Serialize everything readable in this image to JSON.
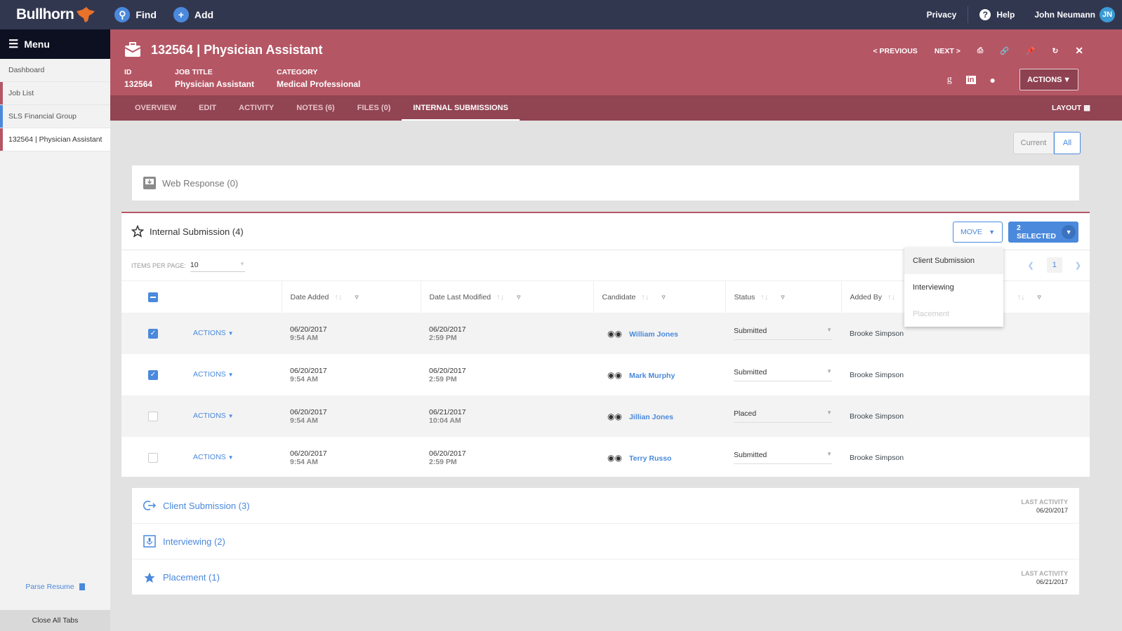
{
  "topbar": {
    "brand": "Bullhorn",
    "find_label": "Find",
    "add_label": "Add",
    "privacy_label": "Privacy",
    "help_label": "Help",
    "user_name": "John Neumann",
    "user_initials": "JN"
  },
  "sidebar": {
    "menu_label": "Menu",
    "items": [
      {
        "label": "Dashboard",
        "color": ""
      },
      {
        "label": "Job List",
        "color": "#b55665"
      },
      {
        "label": "SLS Financial Group",
        "color": "#4a89dc"
      },
      {
        "label": "132564 | Physician Assistant",
        "color": "#b55665"
      }
    ],
    "parse_resume_label": "Parse Resume",
    "close_all_label": "Close All Tabs"
  },
  "header": {
    "title": "132564 | Physician Assistant",
    "fields": [
      {
        "label": "ID",
        "value": "132564"
      },
      {
        "label": "JOB TITLE",
        "value": "Physician Assistant"
      },
      {
        "label": "CATEGORY",
        "value": "Medical Professional"
      }
    ],
    "previous_label": "< PREVIOUS",
    "next_label": "NEXT >",
    "actions_label": "ACTIONS"
  },
  "tabs": {
    "items": [
      "OVERVIEW",
      "EDIT",
      "ACTIVITY",
      "NOTES (6)",
      "FILES (0)",
      "INTERNAL SUBMISSIONS"
    ],
    "active": "INTERNAL SUBMISSIONS",
    "layout_label": "LAYOUT"
  },
  "toggle": {
    "current_label": "Current",
    "all_label": "All",
    "selected": "All"
  },
  "web_response": {
    "label": "Web Response (0)"
  },
  "internal": {
    "title": "Internal Submission (4)",
    "move_label": "MOVE",
    "selected_label": "2 SELECTED",
    "items_per_page_label": "ITEMS PER PAGE:",
    "items_per_page_value": "10",
    "page": "1",
    "columns": [
      "Date Added",
      "Date Last Modified",
      "Candidate",
      "Status",
      "Added By"
    ],
    "row_action_label": "ACTIONS",
    "rows": [
      {
        "checked": true,
        "date_added": "06/20/2017",
        "time_added": "9:54 AM",
        "date_modified": "06/20/2017",
        "time_modified": "2:59 PM",
        "candidate": "William Jones",
        "status": "Submitted",
        "added_by": "Brooke Simpson"
      },
      {
        "checked": true,
        "date_added": "06/20/2017",
        "time_added": "9:54 AM",
        "date_modified": "06/20/2017",
        "time_modified": "2:59 PM",
        "candidate": "Mark Murphy",
        "status": "Submitted",
        "added_by": "Brooke Simpson"
      },
      {
        "checked": false,
        "date_added": "06/20/2017",
        "time_added": "9:54 AM",
        "date_modified": "06/21/2017",
        "time_modified": "10:04 AM",
        "candidate": "Jillian Jones",
        "status": "Placed",
        "added_by": "Brooke Simpson"
      },
      {
        "checked": false,
        "date_added": "06/20/2017",
        "time_added": "9:54 AM",
        "date_modified": "06/20/2017",
        "time_modified": "2:59 PM",
        "candidate": "Terry Russo",
        "status": "Submitted",
        "added_by": "Brooke Simpson"
      }
    ]
  },
  "move_menu": {
    "options": [
      {
        "label": "Client Submission",
        "state": "hover"
      },
      {
        "label": "Interviewing",
        "state": "normal"
      },
      {
        "label": "Placement",
        "state": "disabled"
      }
    ]
  },
  "stages": [
    {
      "label": "Client Submission (3)",
      "icon": "send-icon",
      "last_activity_label": "LAST ACTIVITY",
      "last_activity": "06/20/2017"
    },
    {
      "label": "Interviewing (2)",
      "icon": "microphone-icon",
      "last_activity_label": "",
      "last_activity": ""
    },
    {
      "label": "Placement (1)",
      "icon": "star-icon",
      "last_activity_label": "LAST ACTIVITY",
      "last_activity": "06/21/2017"
    }
  ],
  "colors": {
    "accent": "#4a89dc",
    "header": "#b55665",
    "tabs": "#914452",
    "topbar": "#323750"
  }
}
